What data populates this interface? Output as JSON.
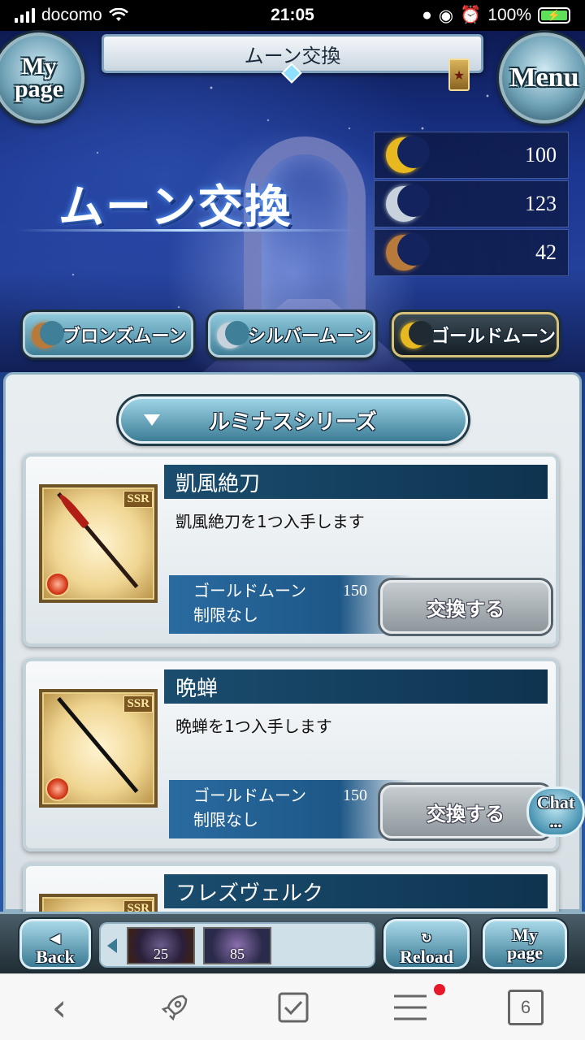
{
  "status_bar": {
    "carrier": "docomo",
    "time": "21:05",
    "battery": "100%"
  },
  "header": {
    "title": "ムーン交換",
    "mypage_label": "My page",
    "menu_label": "Menu"
  },
  "hero": {
    "title": "ムーン交換"
  },
  "currencies": [
    {
      "name": "gold-moon",
      "value": "100",
      "color": "#e8b820"
    },
    {
      "name": "silver-moon",
      "value": "123",
      "color": "#c8d2dc"
    },
    {
      "name": "bronze-moon",
      "value": "42",
      "color": "#b87a3a"
    }
  ],
  "tabs": [
    {
      "label": "ブロンズムーン",
      "active": false
    },
    {
      "label": "シルバームーン",
      "active": false
    },
    {
      "label": "ゴールドムーン",
      "active": true
    }
  ],
  "series": {
    "label": "ルミナスシリーズ"
  },
  "items": [
    {
      "name": "凱風絶刀",
      "rarity": "SSR",
      "description": "凱風絶刀を1つ入手します",
      "cost_currency": "ゴールドムーン",
      "cost": "150",
      "limit": "制限なし",
      "button": "交換する"
    },
    {
      "name": "晩蝉",
      "rarity": "SSR",
      "description": "晩蝉を1つ入手します",
      "cost_currency": "ゴールドムーン",
      "cost": "150",
      "limit": "制限なし",
      "button": "交換する"
    },
    {
      "name": "フレズヴェルク",
      "rarity": "SSR"
    }
  ],
  "chat": {
    "label": "Chat"
  },
  "game_bar": {
    "back": "Back",
    "reload": "Reload",
    "mypage": "My page",
    "raids": [
      "25",
      "85"
    ]
  },
  "browser_bar": {
    "tab_count": "6"
  }
}
